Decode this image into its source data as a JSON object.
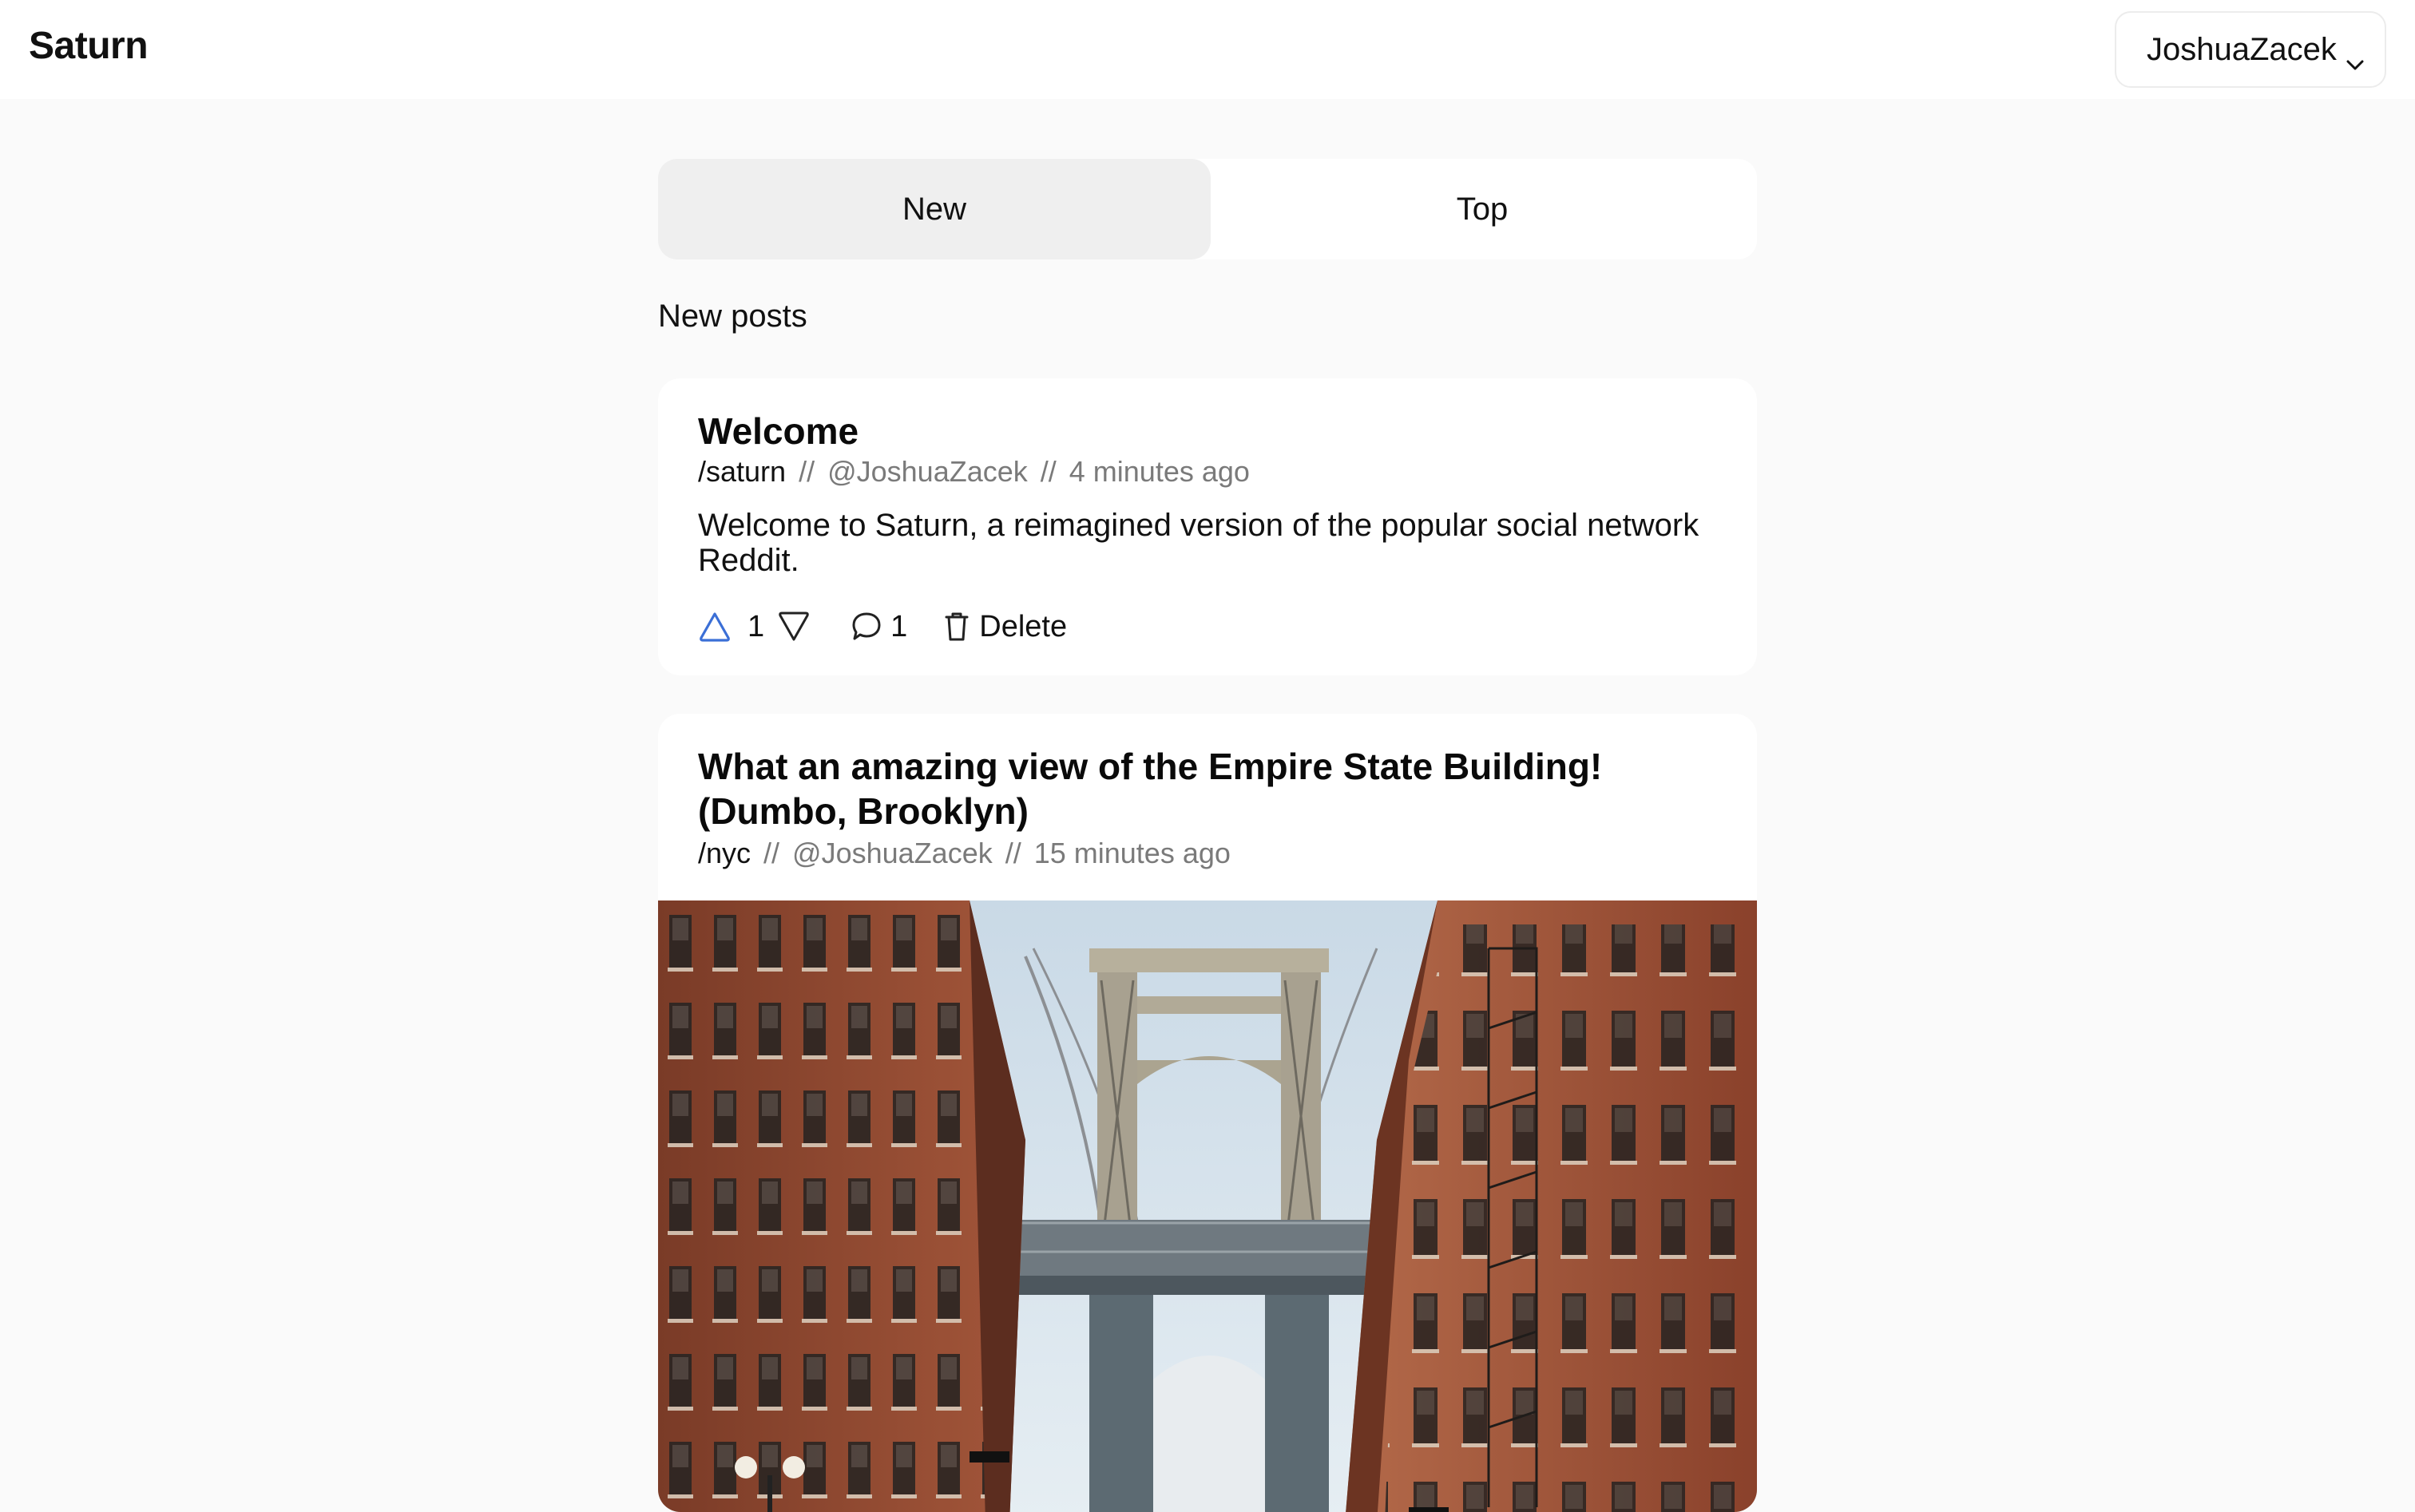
{
  "app": {
    "brand": "Saturn"
  },
  "user_menu": {
    "username": "JoshuaZacek"
  },
  "tabs": [
    {
      "label": "New",
      "selected": true
    },
    {
      "label": "Top",
      "selected": false
    }
  ],
  "section_title": "New posts",
  "posts": [
    {
      "title": "Welcome",
      "subreddit": "/saturn",
      "author": "@JoshuaZacek",
      "time": "4 minutes ago",
      "separator": "//",
      "body": "Welcome to Saturn, a reimagined version of the popular social network Reddit.",
      "votes": "1",
      "comments": "1",
      "delete_label": "Delete"
    },
    {
      "title": "What an amazing view of the Empire State Building! (Dumbo, Brooklyn)",
      "subreddit": "/nyc",
      "author": "@JoshuaZacek",
      "time": "15 minutes ago",
      "separator": "//"
    }
  ],
  "colors": {
    "accent": "#3b6fd6",
    "background": "#fafafa",
    "card": "#ffffff",
    "tab_selected": "#efefef"
  },
  "icons": [
    "chevron-down-icon",
    "upvote-icon",
    "downvote-icon",
    "comment-icon",
    "trash-icon"
  ]
}
